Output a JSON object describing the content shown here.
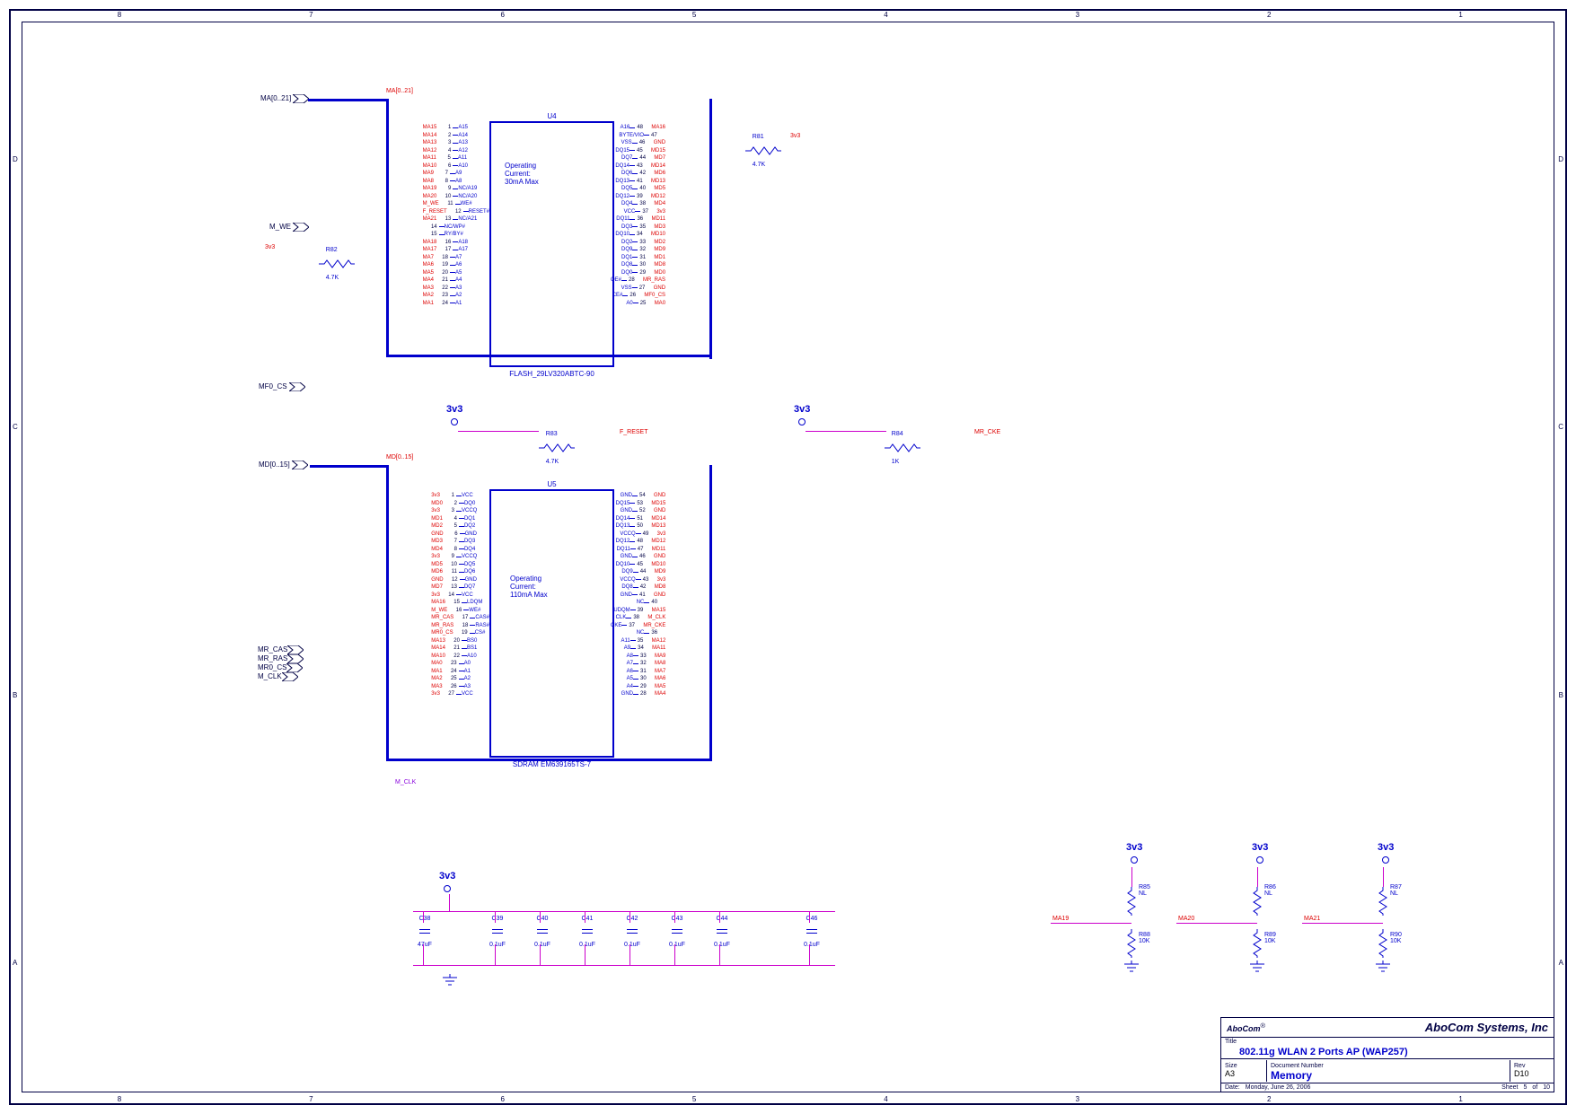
{
  "ruler_cols": [
    "8",
    "7",
    "6",
    "5",
    "4",
    "3",
    "2",
    "1"
  ],
  "ruler_rows": [
    "A",
    "B",
    "C",
    "D"
  ],
  "busses": {
    "ma": {
      "port_ref": "MA[0..21]",
      "net": "MA[0..21]"
    },
    "md": {
      "port_ref": "MD[0..15]",
      "net": "MD[0..15]"
    }
  },
  "ports": {
    "m_we": "M_WE",
    "mf0_cs": "MF0_CS",
    "mr_cas": "MR_CAS",
    "mr_ras": "MR_RAS",
    "mr0_cs": "MR0_CS",
    "m_clk": "M_CLK"
  },
  "u4": {
    "ref": "U4",
    "name": "FLASH_29LV320ABTC-90",
    "note": "Operating\nCurrent:\n30mA Max",
    "left": [
      {
        "n": "1",
        "p": "A15",
        "net": "MA15"
      },
      {
        "n": "2",
        "p": "A14",
        "net": "MA14"
      },
      {
        "n": "3",
        "p": "A13",
        "net": "MA13"
      },
      {
        "n": "4",
        "p": "A12",
        "net": "MA12"
      },
      {
        "n": "5",
        "p": "A11",
        "net": "MA11"
      },
      {
        "n": "6",
        "p": "A10",
        "net": "MA10"
      },
      {
        "n": "7",
        "p": "A9",
        "net": "MA9"
      },
      {
        "n": "8",
        "p": "A8",
        "net": "MA8"
      },
      {
        "n": "9",
        "p": "NC/A19",
        "net": "MA19"
      },
      {
        "n": "10",
        "p": "NC/A20",
        "net": "MA20"
      },
      {
        "n": "11",
        "p": "WE#",
        "net": "M_WE"
      },
      {
        "n": "12",
        "p": "RESET#",
        "net": "F_RESET"
      },
      {
        "n": "13",
        "p": "NC/A21",
        "net": "MA21"
      },
      {
        "n": "14",
        "p": "NC/WP#",
        "net": ""
      },
      {
        "n": "15",
        "p": "RY/BY#",
        "net": ""
      },
      {
        "n": "16",
        "p": "A18",
        "net": "MA18"
      },
      {
        "n": "17",
        "p": "A17",
        "net": "MA17"
      },
      {
        "n": "18",
        "p": "A7",
        "net": "MA7"
      },
      {
        "n": "19",
        "p": "A6",
        "net": "MA6"
      },
      {
        "n": "20",
        "p": "A5",
        "net": "MA5"
      },
      {
        "n": "21",
        "p": "A4",
        "net": "MA4"
      },
      {
        "n": "22",
        "p": "A3",
        "net": "MA3"
      },
      {
        "n": "23",
        "p": "A2",
        "net": "MA2"
      },
      {
        "n": "24",
        "p": "A1",
        "net": "MA1"
      }
    ],
    "right": [
      {
        "n": "48",
        "p": "A16",
        "net": "MA16"
      },
      {
        "n": "47",
        "p": "BYTE/VIO",
        "net": ""
      },
      {
        "n": "46",
        "p": "VSS",
        "net": "GND"
      },
      {
        "n": "45",
        "p": "DQ15",
        "net": "MD15"
      },
      {
        "n": "44",
        "p": "DQ7",
        "net": "MD7"
      },
      {
        "n": "43",
        "p": "DQ14",
        "net": "MD14"
      },
      {
        "n": "42",
        "p": "DQ6",
        "net": "MD6"
      },
      {
        "n": "41",
        "p": "DQ13",
        "net": "MD13"
      },
      {
        "n": "40",
        "p": "DQ5",
        "net": "MD5"
      },
      {
        "n": "39",
        "p": "DQ12",
        "net": "MD12"
      },
      {
        "n": "38",
        "p": "DQ4",
        "net": "MD4"
      },
      {
        "n": "37",
        "p": "VCC",
        "net": "3v3"
      },
      {
        "n": "36",
        "p": "DQ11",
        "net": "MD11"
      },
      {
        "n": "35",
        "p": "DQ3",
        "net": "MD3"
      },
      {
        "n": "34",
        "p": "DQ10",
        "net": "MD10"
      },
      {
        "n": "33",
        "p": "DQ2",
        "net": "MD2"
      },
      {
        "n": "32",
        "p": "DQ9",
        "net": "MD9"
      },
      {
        "n": "31",
        "p": "DQ1",
        "net": "MD1"
      },
      {
        "n": "30",
        "p": "DQ8",
        "net": "MD8"
      },
      {
        "n": "29",
        "p": "DQ0",
        "net": "MD0"
      },
      {
        "n": "28",
        "p": "OE#",
        "net": "MR_RAS"
      },
      {
        "n": "27",
        "p": "VSS",
        "net": "GND"
      },
      {
        "n": "26",
        "p": "CE#",
        "net": "MF0_CS"
      },
      {
        "n": "25",
        "p": "A0",
        "net": "MA0"
      }
    ]
  },
  "u5": {
    "ref": "U5",
    "name": "SDRAM EM639165TS-7",
    "note": "Operating\nCurrent:\n110mA Max",
    "left": [
      {
        "n": "1",
        "p": "VCC",
        "net": "3v3"
      },
      {
        "n": "2",
        "p": "DQ0",
        "net": "MD0"
      },
      {
        "n": "3",
        "p": "VCCQ",
        "net": "3v3"
      },
      {
        "n": "4",
        "p": "DQ1",
        "net": "MD1"
      },
      {
        "n": "5",
        "p": "DQ2",
        "net": "MD2"
      },
      {
        "n": "6",
        "p": "GND",
        "net": "GND"
      },
      {
        "n": "7",
        "p": "DQ3",
        "net": "MD3"
      },
      {
        "n": "8",
        "p": "DQ4",
        "net": "MD4"
      },
      {
        "n": "9",
        "p": "VCCQ",
        "net": "3v3"
      },
      {
        "n": "10",
        "p": "DQ5",
        "net": "MD5"
      },
      {
        "n": "11",
        "p": "DQ6",
        "net": "MD6"
      },
      {
        "n": "12",
        "p": "GND",
        "net": "GND"
      },
      {
        "n": "13",
        "p": "DQ7",
        "net": "MD7"
      },
      {
        "n": "14",
        "p": "VCC",
        "net": "3v3"
      },
      {
        "n": "15",
        "p": "LDQM",
        "net": "MA16"
      },
      {
        "n": "16",
        "p": "WE#",
        "net": "M_WE"
      },
      {
        "n": "17",
        "p": "CAS#",
        "net": "MR_CAS"
      },
      {
        "n": "18",
        "p": "RAS#",
        "net": "MR_RAS"
      },
      {
        "n": "19",
        "p": "CS#",
        "net": "MR0_CS"
      },
      {
        "n": "20",
        "p": "BS0",
        "net": "MA13"
      },
      {
        "n": "21",
        "p": "BS1",
        "net": "MA14"
      },
      {
        "n": "22",
        "p": "A10",
        "net": "MA10"
      },
      {
        "n": "23",
        "p": "A0",
        "net": "MA0"
      },
      {
        "n": "24",
        "p": "A1",
        "net": "MA1"
      },
      {
        "n": "25",
        "p": "A2",
        "net": "MA2"
      },
      {
        "n": "26",
        "p": "A3",
        "net": "MA3"
      },
      {
        "n": "27",
        "p": "VCC",
        "net": "3v3"
      }
    ],
    "right": [
      {
        "n": "54",
        "p": "GND",
        "net": "GND"
      },
      {
        "n": "53",
        "p": "DQ15",
        "net": "MD15"
      },
      {
        "n": "52",
        "p": "GND",
        "net": "GND"
      },
      {
        "n": "51",
        "p": "DQ14",
        "net": "MD14"
      },
      {
        "n": "50",
        "p": "DQ13",
        "net": "MD13"
      },
      {
        "n": "49",
        "p": "VCCQ",
        "net": "3v3"
      },
      {
        "n": "48",
        "p": "DQ12",
        "net": "MD12"
      },
      {
        "n": "47",
        "p": "DQ11",
        "net": "MD11"
      },
      {
        "n": "46",
        "p": "GND",
        "net": "GND"
      },
      {
        "n": "45",
        "p": "DQ10",
        "net": "MD10"
      },
      {
        "n": "44",
        "p": "DQ9",
        "net": "MD9"
      },
      {
        "n": "43",
        "p": "VCCQ",
        "net": "3v3"
      },
      {
        "n": "42",
        "p": "DQ8",
        "net": "MD8"
      },
      {
        "n": "41",
        "p": "GND",
        "net": "GND"
      },
      {
        "n": "40",
        "p": "NC",
        "net": ""
      },
      {
        "n": "39",
        "p": "UDQM",
        "net": "MA15"
      },
      {
        "n": "38",
        "p": "CLK",
        "net": "M_CLK"
      },
      {
        "n": "37",
        "p": "CKE",
        "net": "MR_CKE"
      },
      {
        "n": "36",
        "p": "NC",
        "net": ""
      },
      {
        "n": "35",
        "p": "A11",
        "net": "MA12"
      },
      {
        "n": "34",
        "p": "A9",
        "net": "MA11"
      },
      {
        "n": "33",
        "p": "A8",
        "net": "MA9"
      },
      {
        "n": "32",
        "p": "A7",
        "net": "MA8"
      },
      {
        "n": "31",
        "p": "A6",
        "net": "MA7"
      },
      {
        "n": "30",
        "p": "A5",
        "net": "MA6"
      },
      {
        "n": "29",
        "p": "A4",
        "net": "MA5"
      },
      {
        "n": "28",
        "p": "GND",
        "net": "MA4"
      }
    ]
  },
  "resistors": {
    "r81": {
      "ref": "R81",
      "val": "4.7K",
      "net_l": "",
      "net_r": "3v3"
    },
    "r82": {
      "ref": "R82",
      "val": "4.7K",
      "net_l": "3v3",
      "net_r": ""
    },
    "r83": {
      "ref": "R83",
      "val": "4.7K",
      "net_l": "",
      "net_r": "F_RESET"
    },
    "r84": {
      "ref": "R84",
      "val": "1K",
      "net_l": "",
      "net_r": "MR_CKE"
    },
    "r85": {
      "ref": "R85",
      "val": "NL"
    },
    "r86": {
      "ref": "R86",
      "val": "NL"
    },
    "r87": {
      "ref": "R87",
      "val": "NL"
    },
    "r88": {
      "ref": "R88",
      "val": "10K"
    },
    "r89": {
      "ref": "R89",
      "val": "10K"
    },
    "r90": {
      "ref": "R90",
      "val": "10K"
    }
  },
  "caps": [
    {
      "ref": "C38",
      "val": "47uF"
    },
    {
      "ref": "C39",
      "val": "0.1uF"
    },
    {
      "ref": "C40",
      "val": "0.1uF"
    },
    {
      "ref": "C41",
      "val": "0.1uF"
    },
    {
      "ref": "C42",
      "val": "0.1uF"
    },
    {
      "ref": "C43",
      "val": "0.1uF"
    },
    {
      "ref": "C44",
      "val": "0.1uF"
    },
    {
      "ref": "C46",
      "val": "0.1uF"
    }
  ],
  "pullnets": {
    "a": "MA19",
    "b": "MA20",
    "c": "MA21"
  },
  "pwr": "3v3",
  "net_mclk": "M_CLK",
  "title": {
    "company": "AboCom Systems, Inc",
    "logo": "AboCom",
    "title": "802.11g WLAN 2 Ports AP (WAP257)",
    "docnum": "Memory",
    "size": "A3",
    "rev": "D10",
    "date": "Monday, June 26, 2006",
    "sheet": "5",
    "of": "10",
    "lbl_title": "Title",
    "lbl_size": "Size",
    "lbl_docnum": "Document Number",
    "lbl_rev": "Rev",
    "lbl_date": "Date:",
    "lbl_sheet": "Sheet",
    "lbl_of": "of"
  }
}
